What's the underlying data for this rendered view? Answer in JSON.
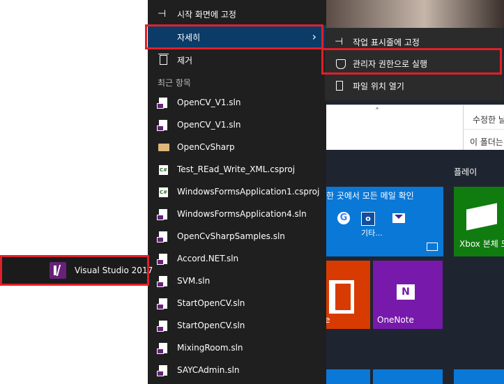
{
  "jumplist": {
    "pin_start_label": "시작 화면에 고정",
    "more_label": "자세히",
    "remove_label": "제거",
    "recent_header": "최근 항목",
    "recent_items": [
      {
        "label": "OpenCV_V1.sln",
        "icon": "vs-solution-icon"
      },
      {
        "label": "OpenCV_V1.sln",
        "icon": "vs-solution-icon"
      },
      {
        "label": "OpenCvSharp",
        "icon": "folder-icon"
      },
      {
        "label": "Test_REad_Write_XML.csproj",
        "icon": "csharp-project-icon"
      },
      {
        "label": "WindowsFormsApplication1.csproj",
        "icon": "csharp-project-icon"
      },
      {
        "label": "WindowsFormsApplication4.sln",
        "icon": "vs-solution-icon"
      },
      {
        "label": "OpenCvSharpSamples.sln",
        "icon": "vs-solution-icon"
      },
      {
        "label": "Accord.NET.sln",
        "icon": "vs-solution-icon"
      },
      {
        "label": "SVM.sln",
        "icon": "vs-solution-icon"
      },
      {
        "label": "StartOpenCV.sln",
        "icon": "vs-solution-icon"
      },
      {
        "label": "StartOpenCV.sln",
        "icon": "vs-solution-icon"
      },
      {
        "label": "MixingRoom.sln",
        "icon": "vs-solution-icon"
      },
      {
        "label": "SAYCAdmin.sln",
        "icon": "vs-solution-icon"
      }
    ]
  },
  "submenu": {
    "pin_taskbar_label": "작업 표시줄에 고정",
    "run_admin_label": "관리자 권한으로 실행",
    "open_location_label": "파일 위치 열기"
  },
  "app_entry": {
    "label": "Visual Studio 2017"
  },
  "background": {
    "window_text_1": "수정한 날",
    "window_text_2": "이 폴더는",
    "mail_tile_header": "한 곳에서 모든 메일 확인",
    "mail_tile_more": "기타...",
    "onenote_label": "OneNote",
    "office_label": "e",
    "play_group_label": "플레이",
    "xbox_label": "Xbox 본체 도"
  },
  "colors": {
    "highlight_border": "#e0202a",
    "menu_selected": "#0b3c68",
    "menu_bg": "#1f1f1f",
    "vs_purple": "#68217a"
  }
}
